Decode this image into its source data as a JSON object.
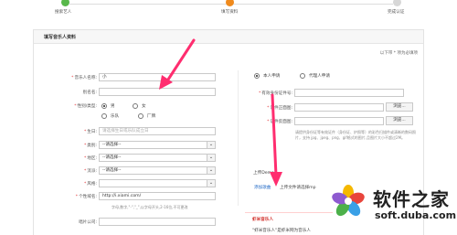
{
  "steps": [
    {
      "label": "搜索艺人",
      "color": "#58b84a"
    },
    {
      "label": "填写资料",
      "color": "#f08a1c"
    },
    {
      "label": "完成认证",
      "color": "#d7d7d7"
    }
  ],
  "panel": {
    "title": "填写音乐人资料",
    "required_note": "以下带 * 项为必填项"
  },
  "left_form": {
    "musician_name": {
      "label": "音乐人名称:",
      "value": "小"
    },
    "alias": {
      "label": "别名名:",
      "value": ""
    },
    "type": {
      "label": "性别/类型:",
      "options": [
        "男",
        "女",
        "乐队",
        "厂牌"
      ],
      "selected": "男"
    },
    "birthday": {
      "label": "生日:",
      "placeholder": "请选择生日或乐队成立日"
    },
    "genre": {
      "label": "类别:",
      "value": "--请选择--"
    },
    "region": {
      "label": "地区:",
      "value": "--请选择--"
    },
    "style_a": {
      "label": "流派:",
      "value": "--请选择--"
    },
    "style_b": {
      "label": "风格:",
      "value": ""
    },
    "domain": {
      "label": "个性域名:",
      "value": "http://i.xiami.com/"
    },
    "domain_hint": "字母,数字,\"-\",\"_\",以字母开头,2-16位,不可更改",
    "company": {
      "label": "唱片公司:",
      "value": ""
    }
  },
  "right_form": {
    "apply_types": [
      "本人申请",
      "代理人申请"
    ],
    "apply_selected": "本人申请",
    "id_number": {
      "label": "有效身份证件号:",
      "value": ""
    },
    "id_front": {
      "label": "证件正面图:",
      "button": "浏览..."
    },
    "id_back": {
      "label": "证件反面图:",
      "button": "浏览..."
    },
    "upload_hint": "请提供身份证等有效证件（身份证、护照等）的彩色扫描件或清晰的数码照片，支持 jpg、jpeg、png、gif格式的图片,且图片大小不超过2M。",
    "demo_label": "上传Demo",
    "add_works_link": "添加歌曲",
    "upload_file_label": "上传文件请选择mp",
    "xiami_title": "虾米音乐人",
    "xiami_text": "\"虾米音乐人\"是虾米网为音乐人"
  },
  "watermark": {
    "title": "软件之家",
    "url": "soft.duba.com"
  },
  "annotations": {
    "arrow_color": "#ff2d6f"
  }
}
